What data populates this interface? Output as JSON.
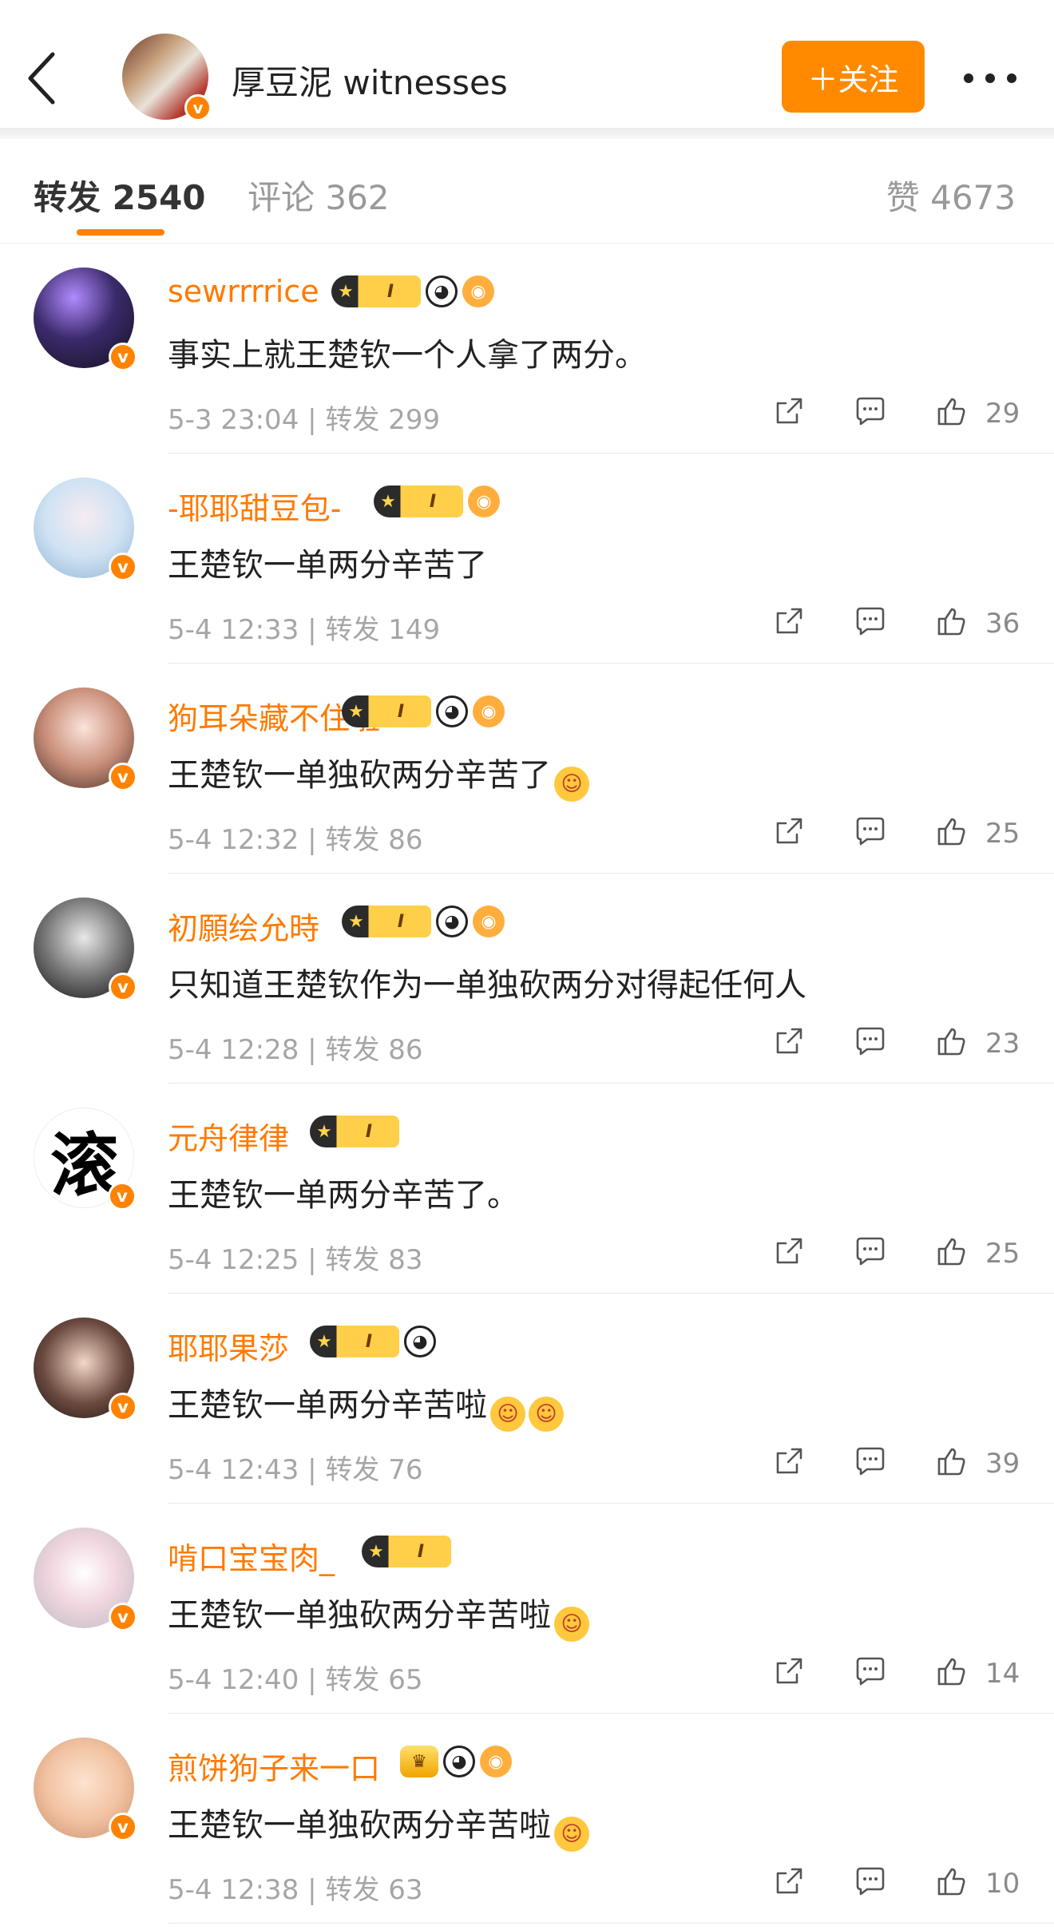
{
  "header": {
    "back_icon": "chevron-left-icon",
    "username": "厚豆泥 witnesses",
    "follow_label": "＋关注",
    "more_icon": "more-horizontal-icon",
    "verified_mark": "v"
  },
  "tabs": {
    "repost": "转发 2540",
    "comment": "评论 362",
    "like": "赞 4673"
  },
  "comments": [
    {
      "name": "sewrrrrice",
      "text": "事实上就王楚钦一个人拿了两分。",
      "time": "5-3 23:04 | 转发 299",
      "likes": "29",
      "v": "v",
      "badges": [
        "crown",
        "panda",
        "fish"
      ]
    },
    {
      "name": "-耶耶甜豆包-",
      "text": "王楚钦一单两分辛苦了",
      "time": "5-4 12:33 | 转发 149",
      "likes": "36",
      "v": "v",
      "badges": [
        "crown",
        "fish"
      ]
    },
    {
      "name": "狗耳朵藏不住啦",
      "text": "王楚钦一单独砍两分辛苦了",
      "time": "5-4 12:32 | 转发 86",
      "likes": "25",
      "v": "v",
      "badges": [
        "crown",
        "panda",
        "fish"
      ]
    },
    {
      "name": "初願绘允時",
      "text": "只知道王楚钦作为一单独砍两分对得起任何人",
      "time": "5-4 12:28 | 转发 86",
      "likes": "23",
      "v": "v",
      "badges": [
        "crown",
        "panda",
        "fish"
      ]
    },
    {
      "name": "元舟律律",
      "text": "王楚钦一单两分辛苦了。",
      "time": "5-4 12:25 | 转发 83",
      "likes": "25",
      "v": "v",
      "avatar_text": "滚",
      "badges": [
        "crown"
      ]
    },
    {
      "name": "耶耶果莎",
      "text": "王楚钦一单两分辛苦啦",
      "time": "5-4 12:43 | 转发 76",
      "likes": "39",
      "v": "v",
      "badges": [
        "crown",
        "panda"
      ]
    },
    {
      "name": "啃口宝宝肉_",
      "text": "王楚钦一单独砍两分辛苦啦",
      "time": "5-4 12:40 | 转发 65",
      "likes": "14",
      "v": "v",
      "badges": [
        "crown"
      ]
    },
    {
      "name": "煎饼狗子来一口",
      "text": "王楚钦一单独砍两分辛苦啦",
      "time": "5-4 12:38 | 转发 63",
      "likes": "10",
      "v": "v",
      "badges": [
        "small-crown",
        "panda",
        "fish"
      ]
    }
  ],
  "badge_glyphs": {
    "crown_star": "★",
    "crown_level": "I",
    "panda": "◕",
    "fish": "◉",
    "small_crown": "♛"
  },
  "emoji_glyph": "☺",
  "colors": {
    "accent": "#ff8200",
    "name": "#ff7a00",
    "meta": "#a6a6a6"
  }
}
